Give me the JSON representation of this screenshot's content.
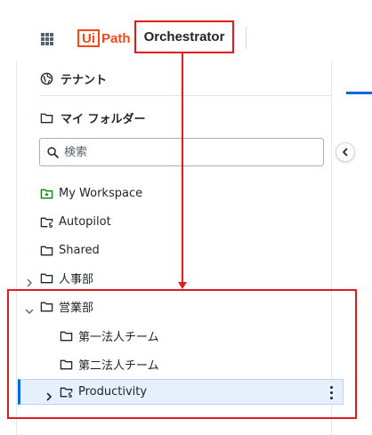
{
  "header": {
    "logo_ui": "Ui",
    "logo_path": "Path",
    "product_name": "Orchestrator"
  },
  "sidebar": {
    "tenant_label": "テナント",
    "my_folders_label": "マイ フォルダー",
    "search": {
      "placeholder": "検索",
      "value": ""
    },
    "tree": [
      {
        "label": "My Workspace",
        "icon": "workspace-folder-icon"
      },
      {
        "label": "Autopilot",
        "icon": "solution-folder-icon"
      },
      {
        "label": "Shared",
        "icon": "folder-icon"
      },
      {
        "label": "人事部",
        "icon": "folder-icon",
        "expanded": false
      },
      {
        "label": "営業部",
        "icon": "folder-icon",
        "expanded": true
      },
      {
        "label": "第一法人チーム",
        "icon": "folder-icon"
      },
      {
        "label": "第二法人チーム",
        "icon": "folder-icon"
      },
      {
        "label": "Productivity",
        "icon": "solution-folder-icon",
        "expanded": false,
        "selected": true
      }
    ]
  },
  "colors": {
    "brand_orange": "#fa4616",
    "accent_blue": "#0067df",
    "annotation_red": "#e01b1b",
    "workspace_green": "#038108"
  }
}
